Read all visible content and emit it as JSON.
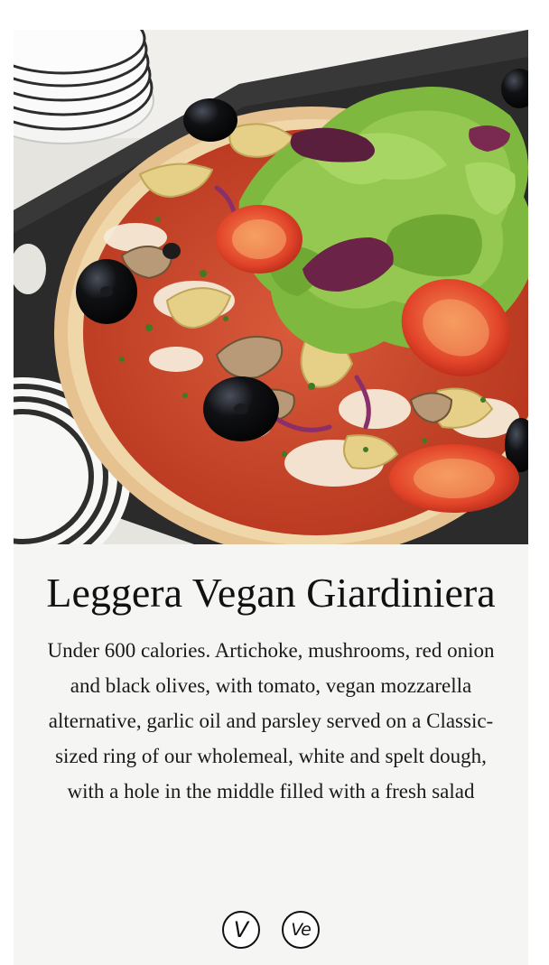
{
  "product": {
    "image_alt": "Leggera Vegan Giardiniera pizza with salad centre",
    "title": "Leggera Vegan Giardiniera",
    "description": "Under 600 calories. Artichoke, mushrooms, red onion and black olives, with tomato, vegan mozzarella alternative, garlic oil and parsley served on a Classic-sized ring of our wholemeal, white and spelt dough, with a hole in the middle filled with a fresh salad",
    "badges": [
      {
        "label": "V",
        "icon": "vegetarian-icon"
      },
      {
        "label": "Ve",
        "icon": "vegan-icon"
      }
    ]
  },
  "colors": {
    "card_background": "#f5f5f3",
    "text": "#111111",
    "board": "#2a2a2a",
    "crust": "#e8c79a",
    "sauce": "#c9452c",
    "lettuce": "#7fb83f"
  }
}
